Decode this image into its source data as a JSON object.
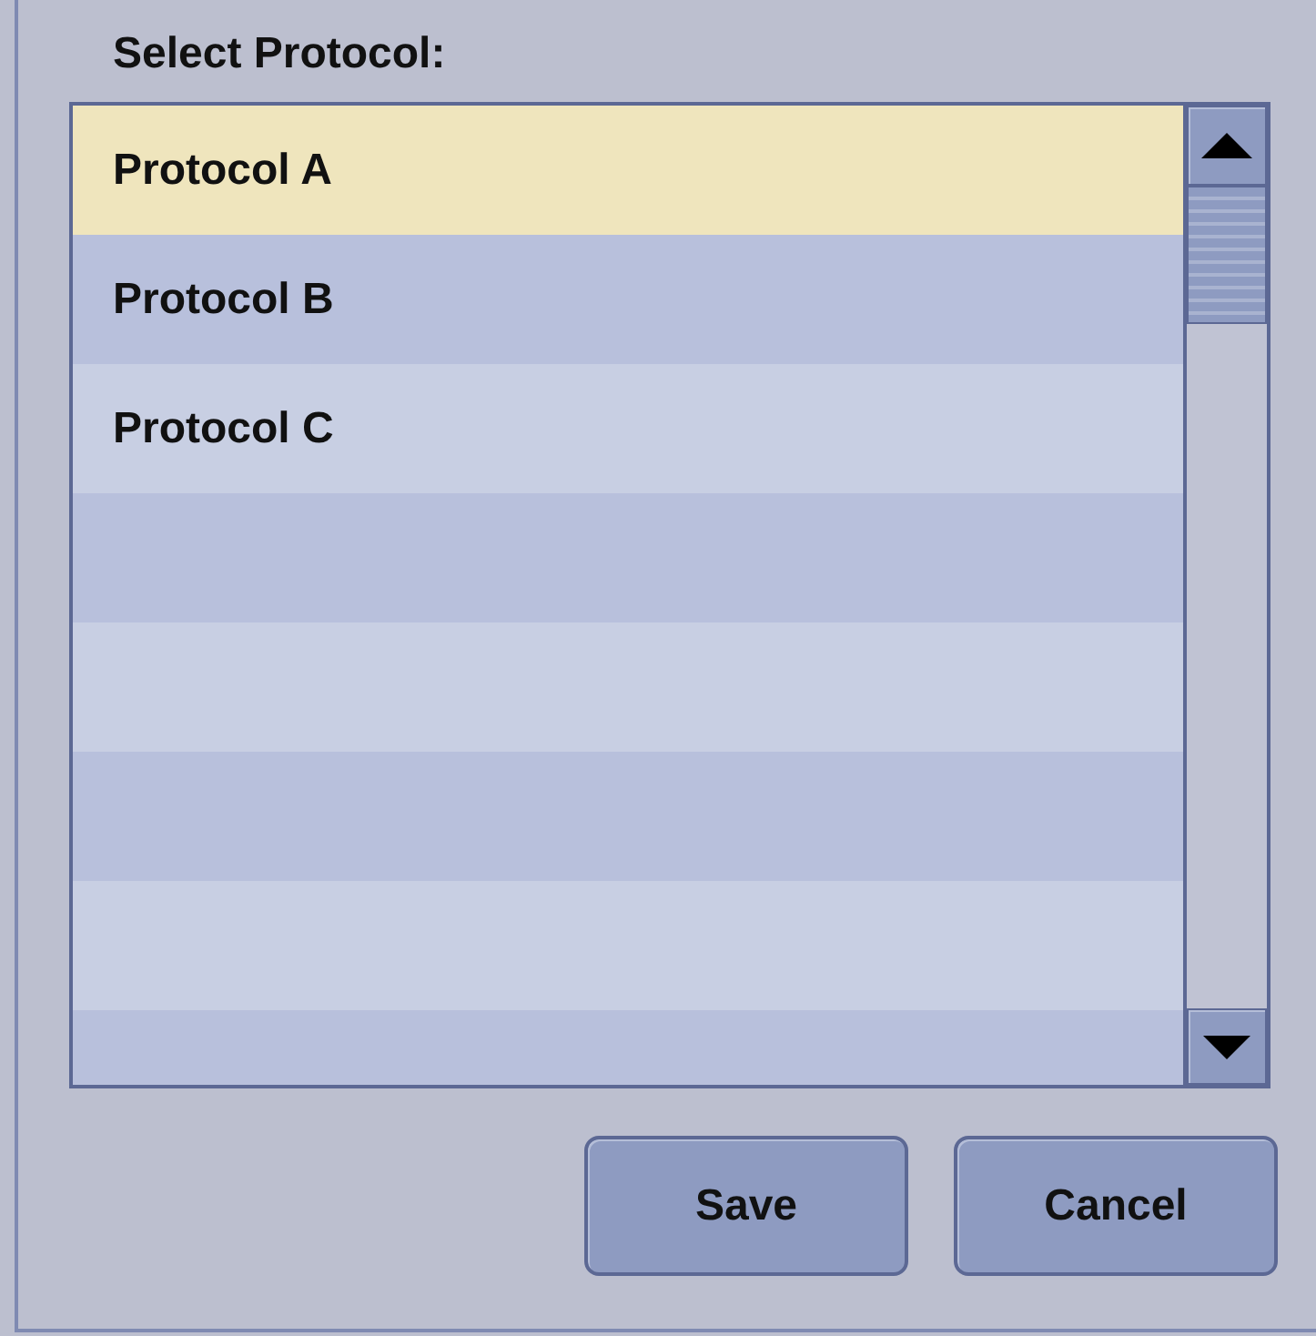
{
  "title": "Select Protocol:",
  "items": [
    {
      "label": "Protocol A",
      "selected": true
    },
    {
      "label": "Protocol B",
      "selected": false
    },
    {
      "label": "Protocol C",
      "selected": false
    }
  ],
  "buttons": [
    {
      "label": "Save"
    },
    {
      "label": "Cancel"
    }
  ]
}
